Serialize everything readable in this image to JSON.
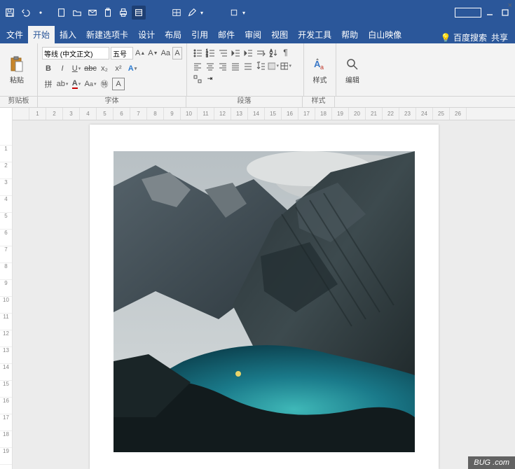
{
  "titlebar": {
    "qat": [
      "save-icon",
      "undo-icon",
      "redo-icon",
      "sep",
      "new-icon",
      "open-icon",
      "mail-icon",
      "clipboard-icon",
      "print-icon",
      "reading-icon"
    ]
  },
  "tabs": {
    "items": [
      "文件",
      "开始",
      "插入",
      "新建选项卡",
      "设计",
      "布局",
      "引用",
      "邮件",
      "审阅",
      "视图",
      "开发工具",
      "帮助",
      "白山映像"
    ],
    "active": 1,
    "tell_me": "百度搜索",
    "share": "共享"
  },
  "ribbon": {
    "clipboard": {
      "paste": "粘贴",
      "label": "剪贴板"
    },
    "font": {
      "name": "等线 (中文正文)",
      "size": "五号",
      "label": "字体"
    },
    "para": {
      "label": "段落"
    },
    "styles": {
      "button": "样式",
      "label": "样式"
    },
    "editing": {
      "button": "编辑",
      "label": ""
    }
  },
  "ruler": {
    "h": [
      "",
      "1",
      "2",
      "3",
      "4",
      "5",
      "6",
      "7",
      "8",
      "9",
      "10",
      "11",
      "12",
      "13",
      "14",
      "15",
      "16",
      "17",
      "18",
      "19",
      "20",
      "21",
      "22",
      "23",
      "24",
      "25",
      "26"
    ]
  },
  "watermark": "BUG .com"
}
